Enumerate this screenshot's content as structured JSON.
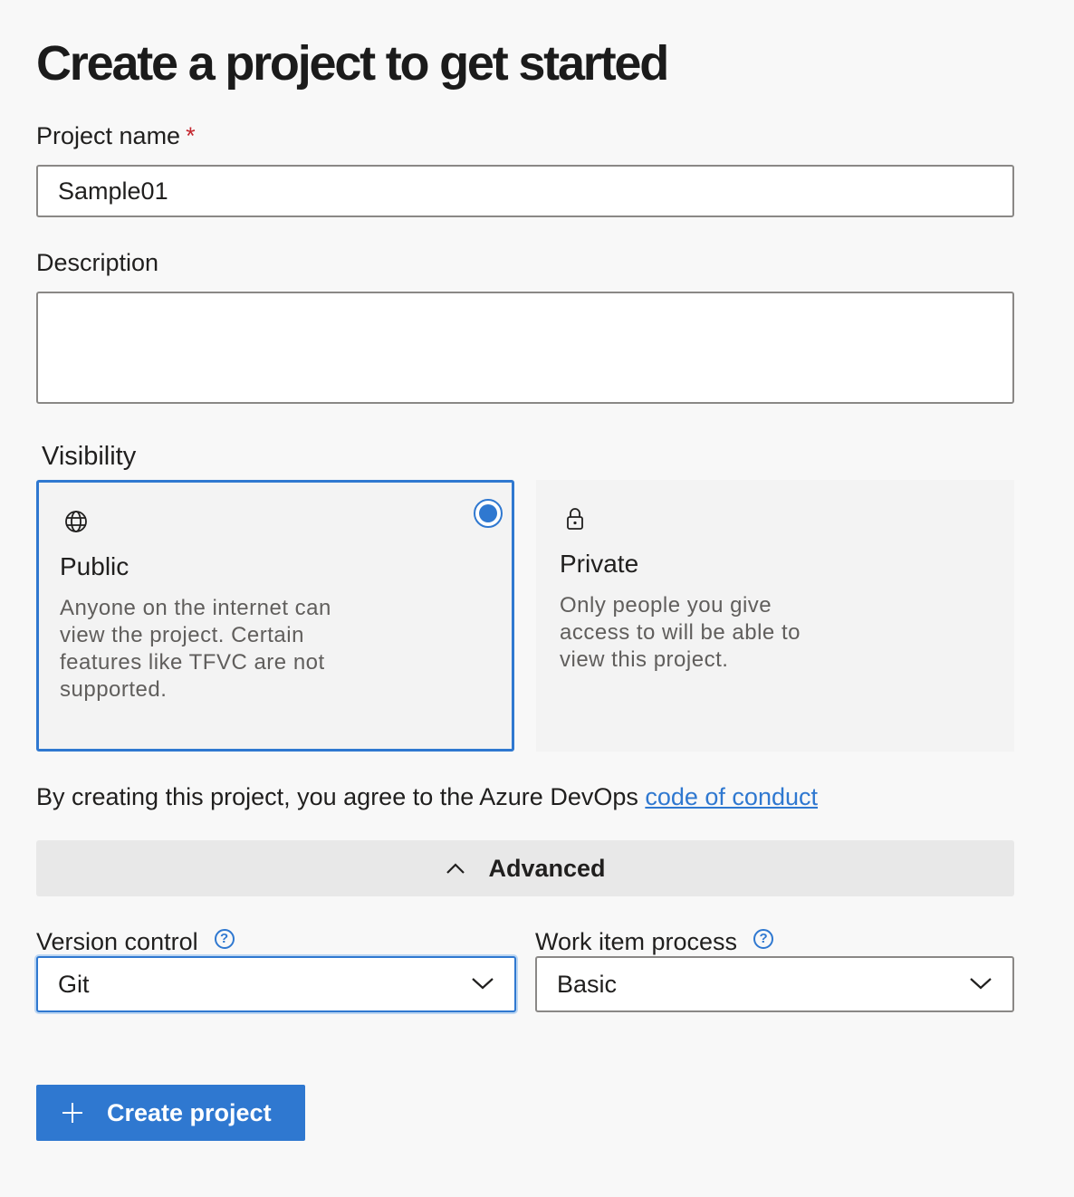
{
  "page": {
    "title": "Create a project to get started"
  },
  "form": {
    "project_name_label": "Project name",
    "required_marker": "*",
    "project_name_value": "Sample01",
    "description_label": "Description",
    "description_value": "",
    "visibility_label": "Visibility"
  },
  "visibility": {
    "public": {
      "title": "Public",
      "description": "Anyone on the internet can view the project. Certain features like TFVC are not supported.",
      "selected": true,
      "icon": "globe-icon"
    },
    "private": {
      "title": "Private",
      "description": "Only people you give access to will be able to view this project.",
      "selected": false,
      "icon": "lock-icon"
    }
  },
  "agreement": {
    "text": "By creating this project, you agree to the Azure DevOps ",
    "link_text": "code of conduct"
  },
  "advanced": {
    "label": "Advanced",
    "icon": "chevron-up-icon",
    "version_control_label": "Version control",
    "version_control_value": "Git",
    "work_item_process_label": "Work item process",
    "work_item_process_value": "Basic",
    "help_glyph": "?"
  },
  "actions": {
    "create_label": "Create project",
    "create_icon": "plus-icon"
  },
  "colors": {
    "accent": "#2f78d0",
    "required": "#c4262e",
    "background": "#f8f8f8"
  }
}
